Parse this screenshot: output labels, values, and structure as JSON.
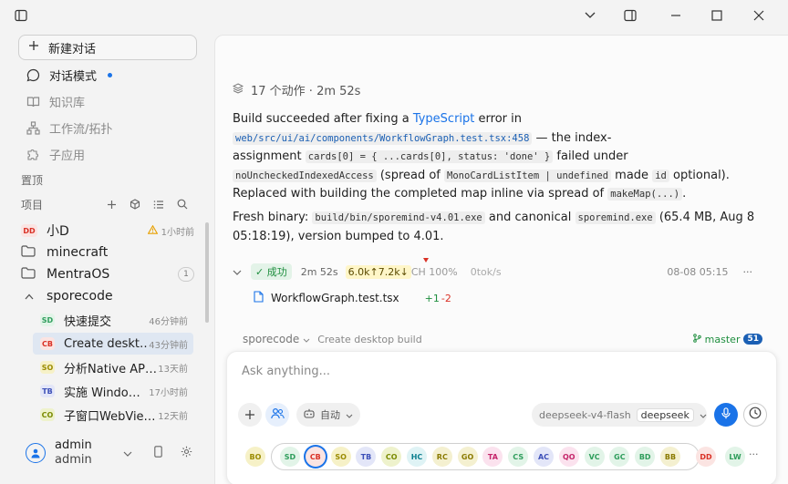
{
  "titlebar": {
    "icons": [
      "sidebar-toggle-icon",
      "chevron-down-icon",
      "split-view-icon",
      "minimize-icon",
      "maximize-icon",
      "close-icon"
    ]
  },
  "sidebar": {
    "new_chat": "新建对话",
    "nav": [
      {
        "label": "对话模式",
        "icon": "chat-bubble-icon",
        "active": true
      },
      {
        "label": "知识库",
        "icon": "book-icon"
      },
      {
        "label": "工作流/拓扑",
        "icon": "workflow-icon"
      },
      {
        "label": "子应用",
        "icon": "puzzle-icon"
      }
    ],
    "pinned_label": "置顶",
    "projects_label": "项目",
    "projects": [
      {
        "badge": "DD",
        "label": "小D",
        "time": "1小时前",
        "warning": true
      },
      {
        "label": "minecraft"
      },
      {
        "label": "MentraOS",
        "count": "1"
      },
      {
        "label": "sporecode",
        "expanded": true
      }
    ],
    "threads": [
      {
        "badge": "SD",
        "label": "快速提交",
        "time": "46分钟前",
        "color": "#2e9d5b",
        "bg": "#e2f4e8"
      },
      {
        "badge": "CB",
        "label": "Create deskt…",
        "time": "43分钟前",
        "color": "#d93025",
        "bg": "#fbe4e2",
        "active": true
      },
      {
        "badge": "SO",
        "label": "分析Native AP…",
        "time": "13天前",
        "color": "#9a8b00",
        "bg": "#f6f1c7"
      },
      {
        "badge": "TB",
        "label": "实施 Windo…",
        "time": "17小时前",
        "color": "#3c4fb8",
        "bg": "#e3e6f8"
      },
      {
        "badge": "CO",
        "label": "子窗口WebVie…",
        "time": "12天前",
        "color": "#7a8a00",
        "bg": "#eef2cc"
      }
    ],
    "user": {
      "name": "admin",
      "role": "admin"
    }
  },
  "main": {
    "actions_summary": "17 个动作 · 2m 52s",
    "p1_a": "Build succeeded after fixing a ",
    "p1_link": "TypeScript",
    "p1_b": " error in",
    "p1_code1": "web/src/ui/ai/components/WorkflowGraph.test.tsx:458",
    "p1_c": " — the index-",
    "p1_d": "assignment ",
    "p1_code2": "cards[0] = { ...cards[0], status: 'done' }",
    "p1_e": " failed under",
    "p1_code3": "noUncheckedIndexedAccess",
    "p1_f": " (spread of ",
    "p1_code4": "MonoCardListItem | undefined",
    "p1_g": " made ",
    "p1_code5": "id",
    "p1_h": " optional).",
    "p1_i": "Replaced with building the completed map inline via spread of ",
    "p1_code6": "makeMap(...)",
    "p1_j": ".",
    "p2_a": "Fresh binary: ",
    "p2_code1": "build/bin/sporemind-v4.01.exe",
    "p2_b": " and canonical ",
    "p2_code2": "sporemind.exe",
    "p2_c": " (65.4 MB, Aug 8",
    "p2_d": "05:18:19), version bumped to 4.01.",
    "status": {
      "ok": "✓ 成功",
      "duration": "2m 52s",
      "tokens": "6.0k↑7.2k↓",
      "cache": "CH 100%",
      "rate": "0tok/s",
      "timestamp": "08-08 05:15",
      "more": "···"
    },
    "file": {
      "name": "WorkflowGraph.test.tsx",
      "added": "+1",
      "removed": "-2"
    },
    "branch": {
      "project": "sporecode",
      "thread": "Create desktop build",
      "name": "master",
      "count": "51"
    }
  },
  "composer": {
    "placeholder": "Ask anything...",
    "mode": "自动",
    "model": "deepseek-v4-flash",
    "provider": "deepseek",
    "agents_left": "BO",
    "agents": [
      {
        "t": "SD",
        "c": "#2e9d5b",
        "bg": "#e2f4e8"
      },
      {
        "t": "CB",
        "c": "#d93025",
        "bg": "#fbe4e2",
        "active": true
      },
      {
        "t": "SO",
        "c": "#9a8b00",
        "bg": "#f6f1c7"
      },
      {
        "t": "TB",
        "c": "#3c4fb8",
        "bg": "#e3e6f8"
      },
      {
        "t": "CO",
        "c": "#7a8a00",
        "bg": "#eef2cc"
      },
      {
        "t": "HC",
        "c": "#0b7f8f",
        "bg": "#dff3f5"
      },
      {
        "t": "RC",
        "c": "#8a7a00",
        "bg": "#f4f0d0"
      },
      {
        "t": "GO",
        "c": "#8a7a00",
        "bg": "#f4f0d0"
      },
      {
        "t": "TA",
        "c": "#c5246a",
        "bg": "#fbe2ee"
      },
      {
        "t": "CS",
        "c": "#2e9d5b",
        "bg": "#e2f4e8"
      },
      {
        "t": "AC",
        "c": "#3c4fb8",
        "bg": "#e3e6f8"
      },
      {
        "t": "QO",
        "c": "#c5246a",
        "bg": "#fbe2ee"
      },
      {
        "t": "VC",
        "c": "#2e9d5b",
        "bg": "#e2f4e8"
      },
      {
        "t": "GC",
        "c": "#2e9d5b",
        "bg": "#e2f4e8"
      },
      {
        "t": "BD",
        "c": "#2e9d5b",
        "bg": "#e2f4e8"
      },
      {
        "t": "BB",
        "c": "#8a7a00",
        "bg": "#f4f0d0"
      }
    ],
    "agents_right": [
      {
        "t": "DD",
        "c": "#d93025",
        "bg": "#fbe4e2"
      },
      {
        "t": "LW",
        "c": "#2e9d5b",
        "bg": "#e2f4e8"
      }
    ],
    "more": "···"
  }
}
